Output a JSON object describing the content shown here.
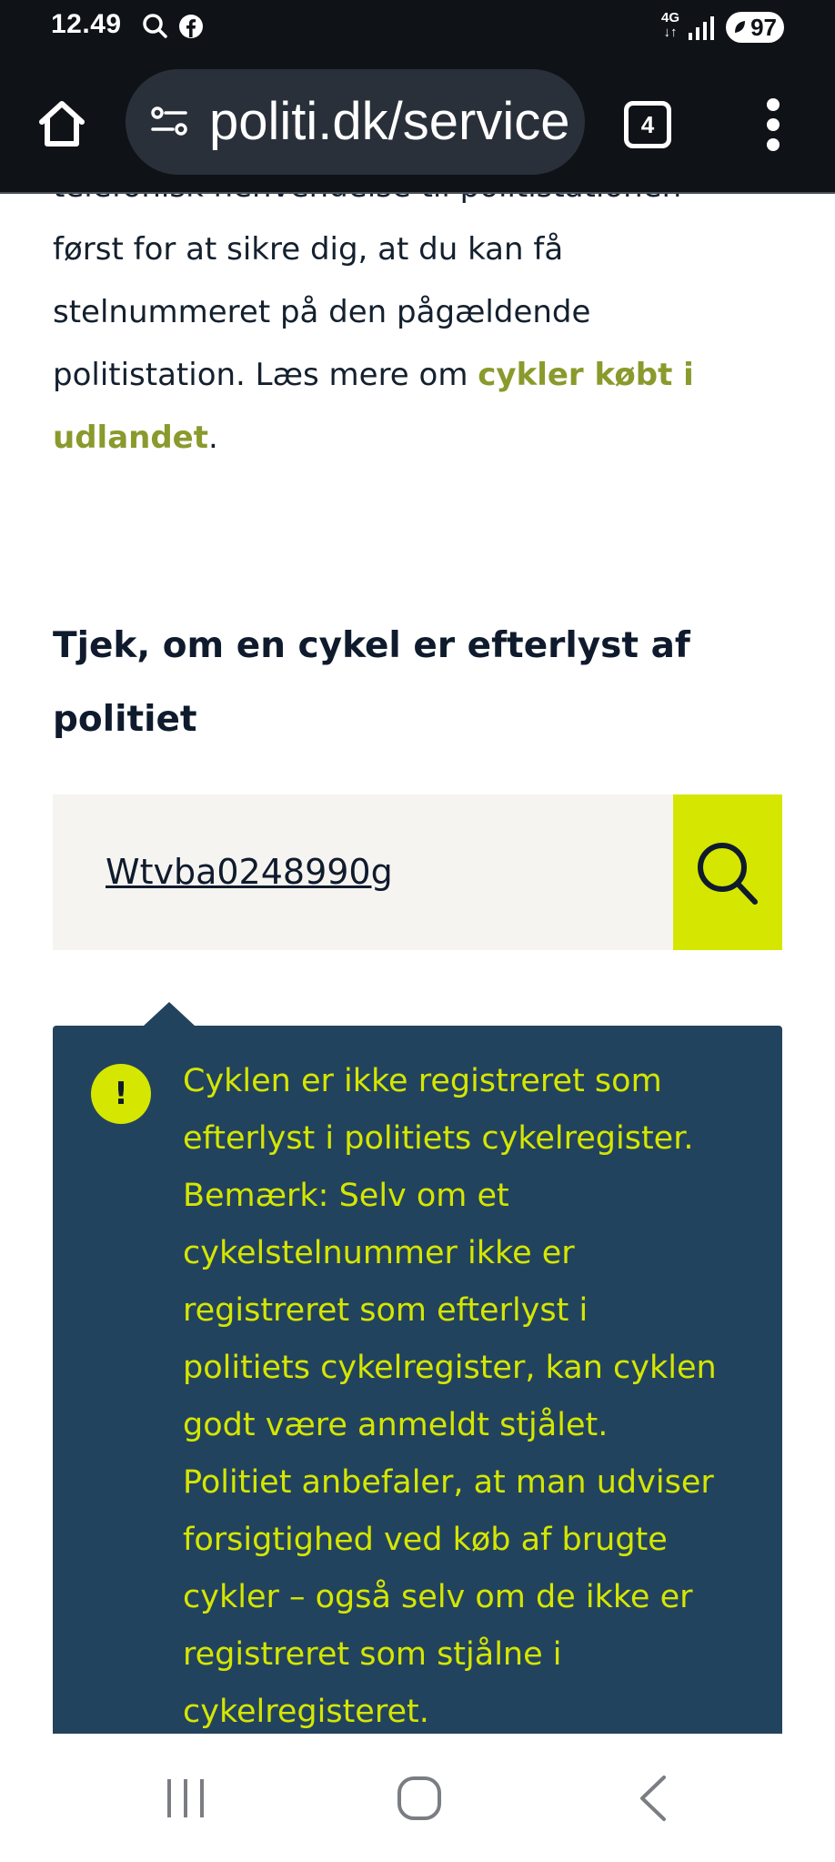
{
  "status_bar": {
    "time": "12.49",
    "network": "4G",
    "battery": "97",
    "icons": [
      "search-icon",
      "facebook-icon",
      "signal-icon",
      "battery-icon"
    ]
  },
  "browser": {
    "url": "politi.dk/service",
    "tab_count": "4",
    "icons": [
      "home-icon",
      "site-info-icon",
      "tabs-icon",
      "more-menu-icon"
    ]
  },
  "page": {
    "intro_lines": [
      "telefonisk henvendelse til politistationen",
      "først for at sikre dig, at du kan få",
      "stelnummeret på den pågældende"
    ],
    "intro_prefix": "politistation. Læs mere om ",
    "intro_link_1": "cykler købt i",
    "intro_link_2": "udlandet",
    "intro_suffix": ".",
    "heading_line_1": "Tjek, om en cykel er efterlyst af",
    "heading_line_2": "politiet",
    "search": {
      "value": "Wtvba0248990g"
    },
    "result": {
      "icon_symbol": "!",
      "lines": [
        "Cyklen er ikke registreret som",
        "efterlyst i politiets cykelregister.",
        "Bemærk: Selv om et",
        "cykelstelnummer ikke er",
        "registreret som efterlyst i",
        "politiets cykelregister, kan cyklen",
        "godt være anmeldt stjålet.",
        "Politiet anbefaler, at man udviser",
        "forsigtighed ved køb af brugte",
        "cykler – også selv om de ikke er",
        "registreret som stjålne i",
        "cykelregisteret."
      ]
    }
  },
  "colors": {
    "accent_lime": "#d5e600",
    "link_olive": "#8a9a2c",
    "panel_navy": "#22435e",
    "search_bg": "#f6f4f0",
    "chrome_dark": "#0f1217"
  },
  "nav_bar": {
    "icons": [
      "recents-icon",
      "home-circle-icon",
      "back-icon"
    ]
  }
}
